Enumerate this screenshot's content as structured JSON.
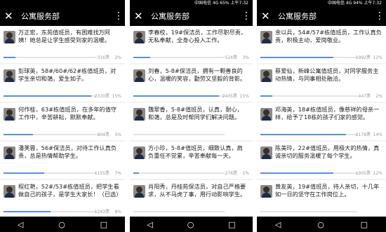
{
  "screens": [
    {
      "status": "",
      "title": "公寓服务部",
      "close": "✕",
      "menu": "⋮",
      "nav": [
        "◁",
        "○",
        "□"
      ],
      "items": [
        {
          "text": "万正宏，东苑值班员，有困难找万阿姨！她总是让学生感受到家的温暖。",
          "votes": "316票",
          "pct": "2%",
          "fill": 0.02
        },
        {
          "text": "彭球英，58#/60#/62#栋值班员，对学生亲切和蔼，爱生如子。",
          "votes": "2330票",
          "pct": "15%",
          "fill": 0.15
        },
        {
          "text": "何作桂，63#栋值班员，在多年的值守工作中，辛苦耕耘，默默奉献。",
          "votes": "804票",
          "pct": "5%",
          "fill": 0.05
        },
        {
          "text": "潘芙蓉，56#保洁员，对待工作认真负责，总是热情帮助学生。",
          "votes": "1155票",
          "pct": "7%",
          "fill": 0.07
        },
        {
          "text": "程红艳，52#/53#栋值班员，把学生看做自己的孩子，是学生大家长！（已选）",
          "votes": "1243票",
          "pct": "8%",
          "fill": 0.08
        }
      ]
    },
    {
      "status": "中国电信 4G 65% 上午7:32",
      "title": "公寓服务部",
      "close": "✕",
      "menu": "⋮",
      "nav": [
        "◁",
        "○",
        "□"
      ],
      "items": [
        {
          "text": "李春校，19#保洁员，工作尽职尽责，无私奉献，全身心投入工作。",
          "votes": "524票",
          "pct": "3%",
          "fill": 0.03
        },
        {
          "text": "刘春，5-8#保洁员，拥有一颗善良的心，温暖的笑容，勤劳又坚毅的背影。",
          "votes": "2405票",
          "pct": "15%",
          "fill": 0.15
        },
        {
          "text": "魏翠香，5-8#值班员，认真，耐心，和蔼，总是及时帮同学们解决问题。",
          "votes": "",
          "pct": "",
          "fill": 0
        },
        {
          "text": "方小珍，5-8#值班员，细致认真，肩负重任不觉累，辛苦奉献每一天。",
          "votes": "276票",
          "pct": "1%",
          "fill": 0.01
        },
        {
          "text": "肖阳秀，丹桂苑保洁员，对自己严格要求，从不马虎了事，用行动影响学生。",
          "votes": "",
          "pct": "",
          "fill": 0
        }
      ]
    },
    {
      "status": "中国电信 4G 94% 上午7:32",
      "title": "公寓服务部",
      "close": "✕",
      "menu": "⋮",
      "nav": [
        "◁",
        "○",
        "□"
      ],
      "items": [
        {
          "text": "余以兵，54#/57#栋值班员，工作认真负责，积极主动，爱岗敬业。",
          "votes": "1992票",
          "pct": "12%",
          "fill": 0.12
        },
        {
          "text": "蔡爱仙，新峰公寓值班员，对同学服务主动热情，与同事相处融洽。",
          "votes": "447票",
          "pct": "2%",
          "fill": 0.02
        },
        {
          "text": "邓海英，18#栋值班员，像慈祥的母亲一样，给予了18栋的孩子们家的感觉。",
          "votes": "2178票",
          "pct": "14%",
          "fill": 0.14
        },
        {
          "text": "陈美玲，22#值班员，用极大的热情，真诚亲切的服务温暖了每个学生。",
          "votes": "1905票",
          "pct": "12%",
          "fill": 0.12
        },
        {
          "text": "黄友英，19#值班员，待人亲切，十几年如一日的坚守在工作岗位上。",
          "votes": "",
          "pct": "",
          "fill": 0
        }
      ]
    }
  ]
}
